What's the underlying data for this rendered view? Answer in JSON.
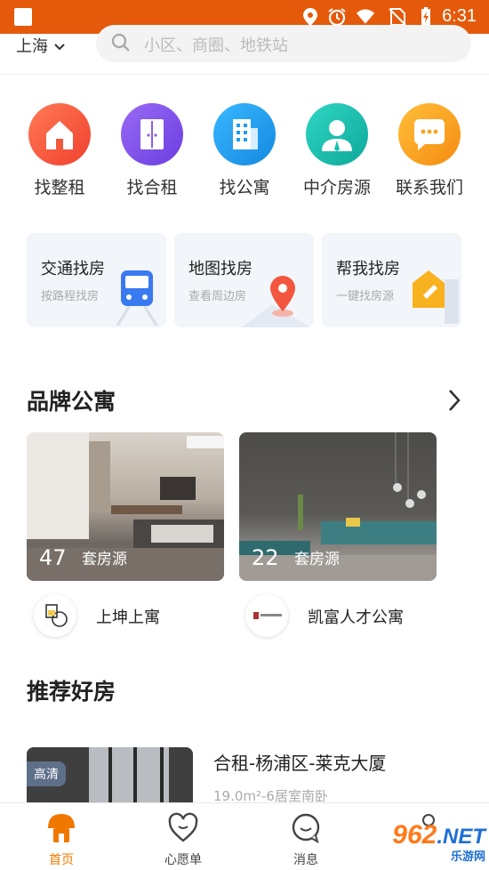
{
  "status_bar": {
    "time": "6:31"
  },
  "header": {
    "city": "上海",
    "search_placeholder": "小区、商圈、地铁站"
  },
  "categories": [
    {
      "label": "找整租",
      "icon": "house-icon",
      "color": "#f25a3c"
    },
    {
      "label": "找合租",
      "icon": "door-icon",
      "color": "#7a4ce8"
    },
    {
      "label": "找公寓",
      "icon": "building-icon",
      "color": "#1e9ef0"
    },
    {
      "label": "中介房源",
      "icon": "agent-icon",
      "color": "#14c0b0"
    },
    {
      "label": "联系我们",
      "icon": "chat-icon",
      "color": "#f7a21b"
    }
  ],
  "feature_cards": [
    {
      "title": "交通找房",
      "subtitle": "按路程找房",
      "icon": "train-icon"
    },
    {
      "title": "地图找房",
      "subtitle": "查看周边房",
      "icon": "map-pin-icon"
    },
    {
      "title": "帮我找房",
      "subtitle": "一键找房源",
      "icon": "help-icon"
    }
  ],
  "brand_section": {
    "title": "品牌公寓",
    "items": [
      {
        "count": "47",
        "unit": "套房源",
        "name": "上坤上寓"
      },
      {
        "count": "22",
        "unit": "套房源",
        "name": "凯富人才公寓"
      }
    ]
  },
  "recommend_section": {
    "title": "推荐好房",
    "listing": {
      "badge": "高清",
      "title": "合租-杨浦区-莱克大厦",
      "subtitle": "19.0m²-6居室南卧"
    }
  },
  "tabbar": [
    {
      "label": "首页",
      "icon": "home-icon",
      "active": true
    },
    {
      "label": "心愿单",
      "icon": "heart-icon",
      "active": false
    },
    {
      "label": "消息",
      "icon": "message-icon",
      "active": false
    }
  ],
  "watermark": {
    "brand": "962",
    "suffix": ".NET",
    "sub": "乐游网"
  },
  "colors": {
    "status_bar": "#e45a0a",
    "accent": "#f07800"
  }
}
